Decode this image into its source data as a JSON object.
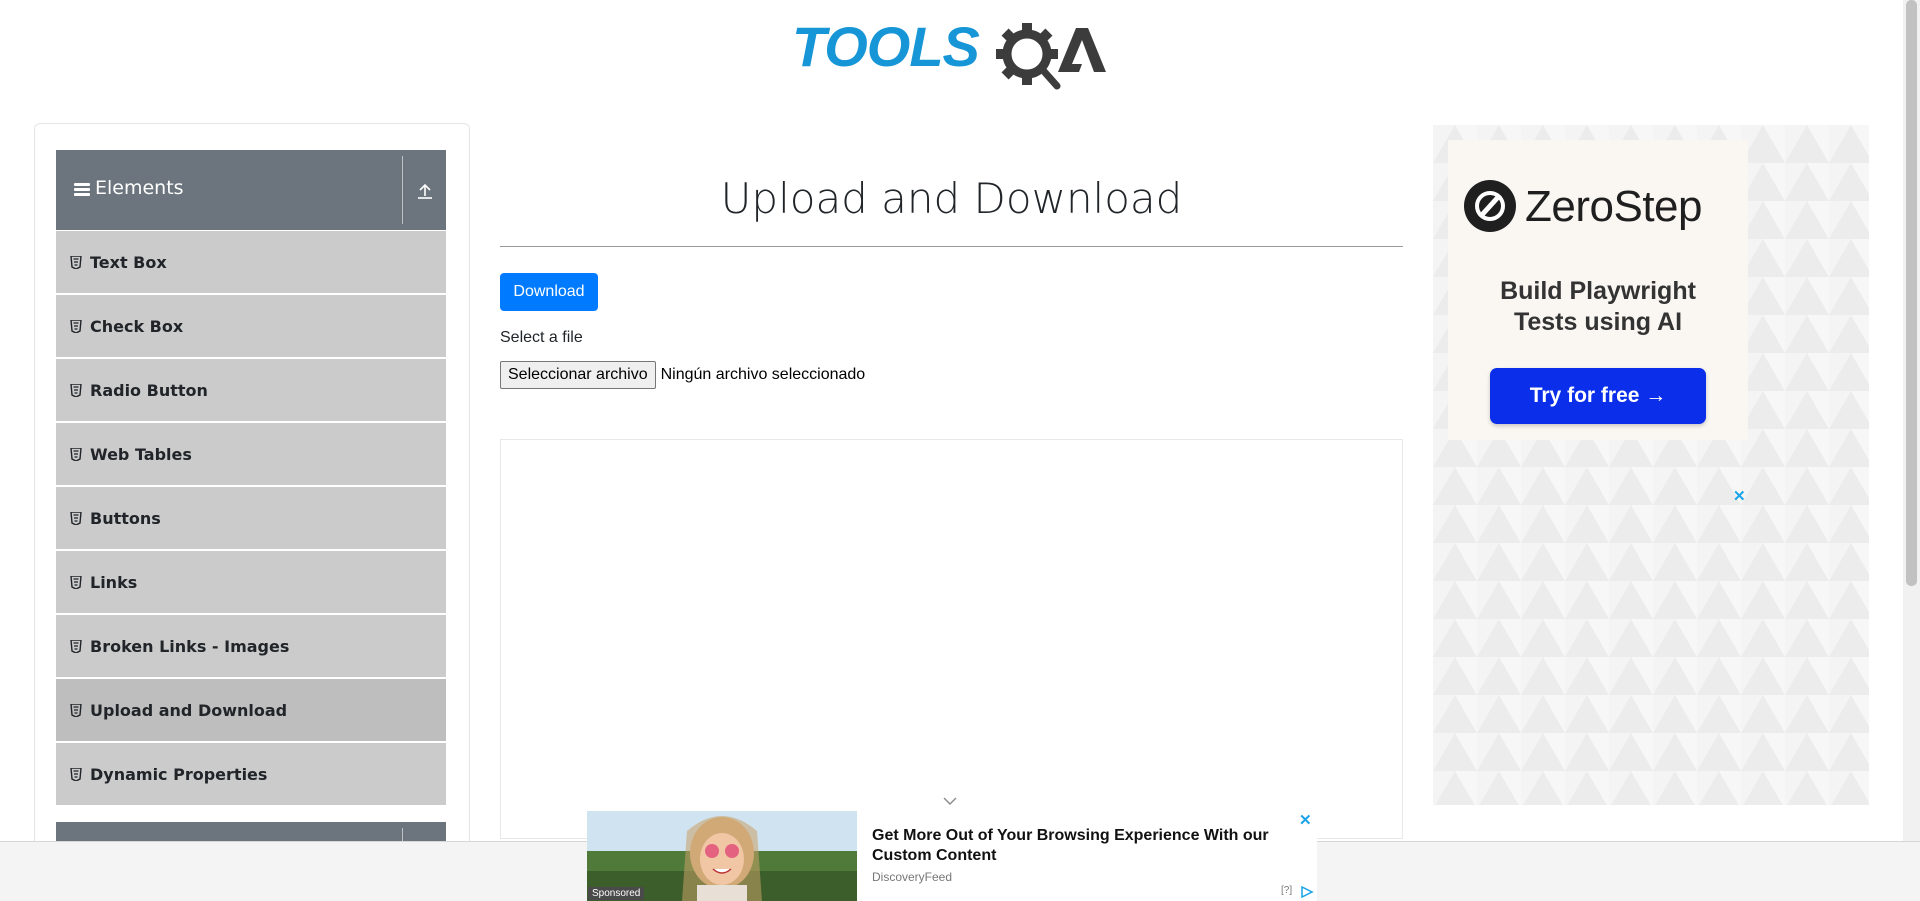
{
  "header": {
    "logo_text": "TOOLSQA"
  },
  "sidebar": {
    "groups": [
      {
        "title": "Elements",
        "items": [
          {
            "label": "Text Box"
          },
          {
            "label": "Check Box"
          },
          {
            "label": "Radio Button"
          },
          {
            "label": "Web Tables"
          },
          {
            "label": "Buttons"
          },
          {
            "label": "Links"
          },
          {
            "label": "Broken Links - Images"
          },
          {
            "label": "Upload and Download",
            "active": true
          },
          {
            "label": "Dynamic Properties"
          }
        ]
      }
    ]
  },
  "main": {
    "title": "Upload and Download",
    "download_label": "Download",
    "file_label": "Select a file",
    "choose_file_label": "Seleccionar archivo",
    "no_file_text": "Ningún archivo seleccionado"
  },
  "right_ad": {
    "brand": "ZeroStep",
    "headline_line1": "Build Playwright",
    "headline_line2": "Tests using AI",
    "cta": "Try for free →",
    "close": "✕"
  },
  "bottom_ad": {
    "sponsored": "Sponsored",
    "headline": "Get More Out of Your Browsing Experience With our Custom Content",
    "source": "DiscoveryFeed",
    "adchoices": "[?]",
    "close": "✕"
  },
  "colors": {
    "primary": "#007bff",
    "sidebar_header": "#6c757d",
    "menu_item": "#cbcbcb",
    "menu_item_active": "#bebebe",
    "logo_blue": "#1696d6",
    "logo_dark": "#3c3c3c",
    "zerostep_cta": "#0a2eea"
  }
}
